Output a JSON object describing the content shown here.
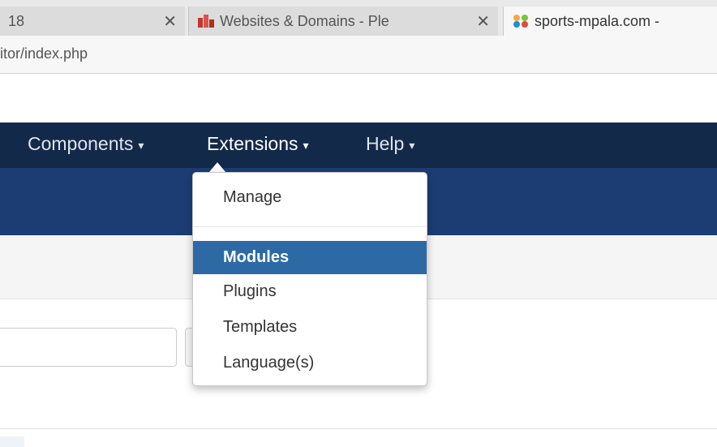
{
  "browser": {
    "tabs": [
      {
        "title": "18",
        "close": "✕"
      },
      {
        "title": "Websites & Domains - Ple",
        "close": "✕"
      },
      {
        "title": "sports-mpala.com -"
      }
    ],
    "url": "itor/index.php"
  },
  "nav": {
    "components": "Components",
    "extensions": "Extensions",
    "help": "Help",
    "caret": "▾"
  },
  "dropdown": {
    "items": [
      "Manage",
      "Modules",
      "Plugins",
      "Templates",
      "Language(s)"
    ]
  },
  "colors": {
    "navbar": "#13294a",
    "header": "#1c3d73",
    "highlight": "#2d6aa5"
  }
}
